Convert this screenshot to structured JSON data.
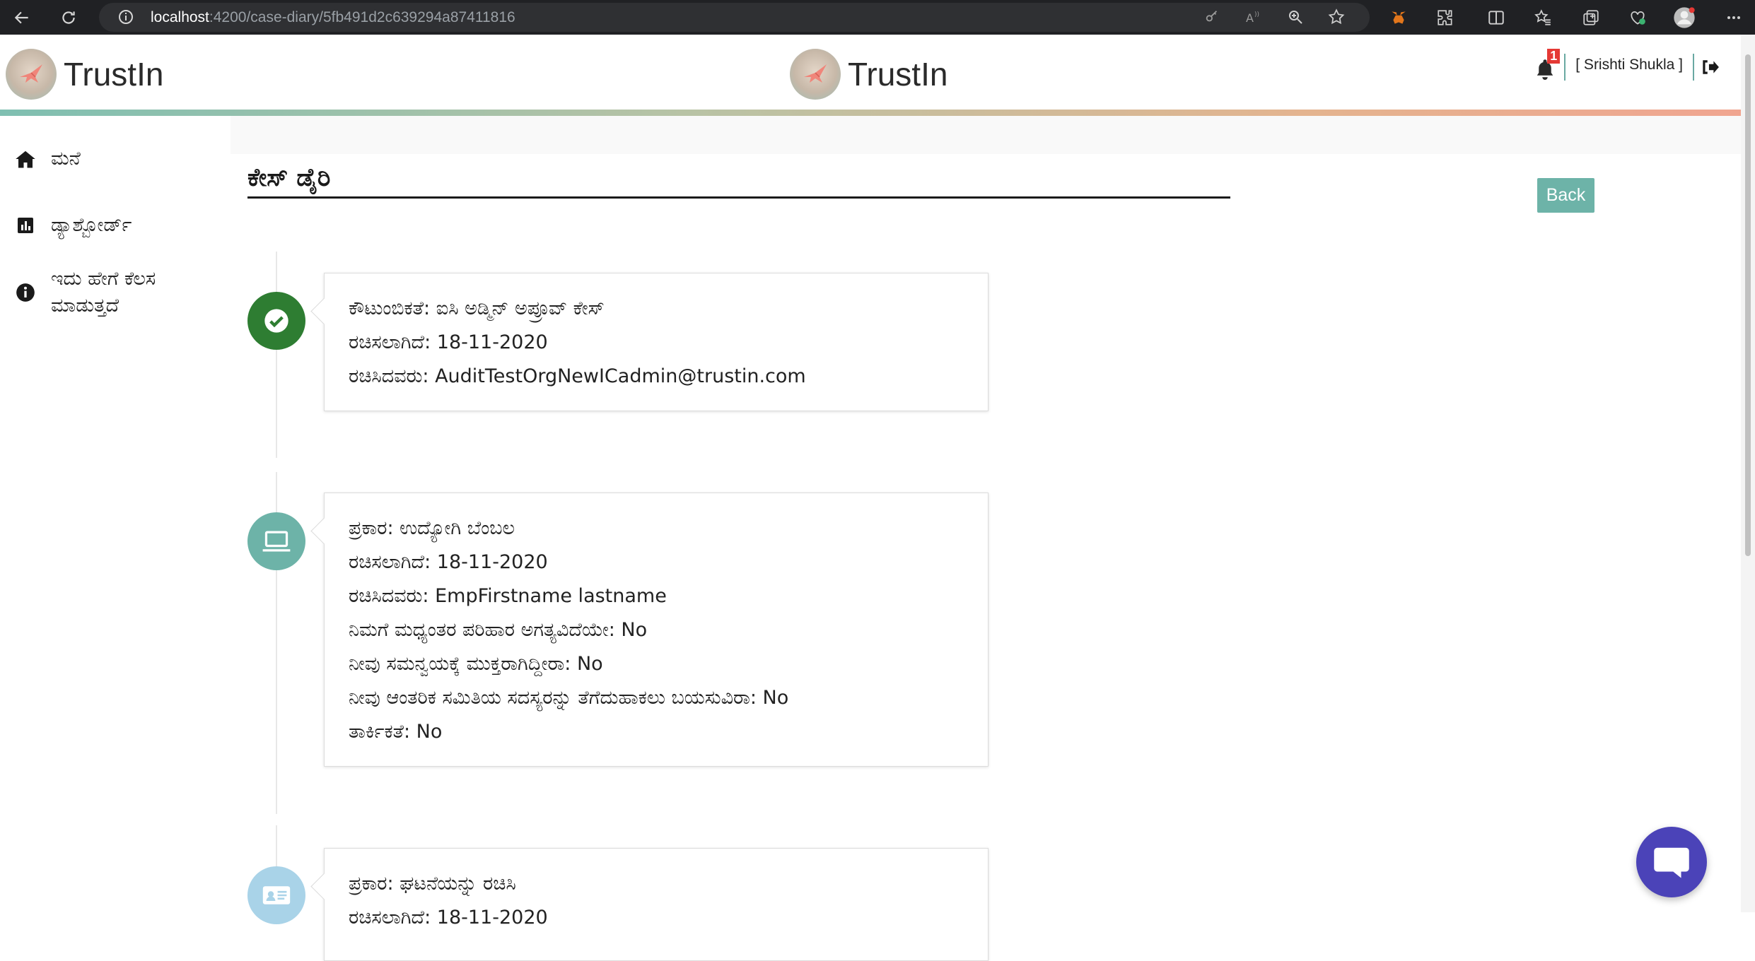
{
  "browser": {
    "url_host": "localhost",
    "url_path": ":4200/case-diary/5fb491d2c639294a87411816"
  },
  "header": {
    "brand_name": "TrustIn",
    "notification_count": "1",
    "user_name": "[ Srishti Shukla ]"
  },
  "sidebar": {
    "items": [
      {
        "label": "ಮನೆ",
        "icon": "home-icon"
      },
      {
        "label": "ಡ್ಯಾಶ್ಬೋರ್ಡ್",
        "icon": "bar-chart-icon"
      },
      {
        "label": "ಇದು ಹೇಗೆ ಕೆಲಸ ಮಾಡುತ್ತದೆ",
        "icon": "info-icon"
      }
    ]
  },
  "page": {
    "title": "ಕೇಸ್ ಡೈರಿ",
    "back_label": "Back"
  },
  "timeline": [
    {
      "icon": "check-circle-icon",
      "color": "#2e7d32",
      "rows": [
        "ಕೌಟುಂಬಿಕತೆ: ಐಸಿ ಅಡ್ಮಿನ್ ಅಪ್ರೂವ್ ಕೇಸ್",
        "ರಚಿಸಲಾಗಿದೆ: 18-11-2020",
        "ರಚಿಸಿದವರು: AuditTestOrgNewICadmin@trustin.com"
      ]
    },
    {
      "icon": "laptop-icon",
      "color": "#6db3a8",
      "rows": [
        "ಪ್ರಕಾರ: ಉದ್ಯೋಗಿ ಬೆಂಬಲ",
        "ರಚಿಸಲಾಗಿದೆ: 18-11-2020",
        "ರಚಿಸಿದವರು: EmpFirstname lastname",
        "ನಿಮಗೆ ಮಧ್ಯಂತರ ಪರಿಹಾರ ಅಗತ್ಯವಿದೆಯೇ: No",
        "ನೀವು ಸಮನ್ವಯಕ್ಕೆ ಮುಕ್ತರಾಗಿದ್ದೀರಾ: No",
        "ನೀವು ಆಂತರಿಕ ಸಮಿತಿಯ ಸದಸ್ಯರನ್ನು ತೆಗೆದುಹಾಕಲು ಬಯಸುವಿರಾ: No",
        "ತಾರ್ಕಿಕತೆ: No"
      ]
    },
    {
      "icon": "id-card-icon",
      "color": "#a9d3e8",
      "rows": [
        "ಪ್ರಕಾರ: ಘಟನೆಯನ್ನು ರಚಿಸಿ",
        "ರಚಿಸಲಾಗಿದೆ: 18-11-2020"
      ]
    }
  ]
}
